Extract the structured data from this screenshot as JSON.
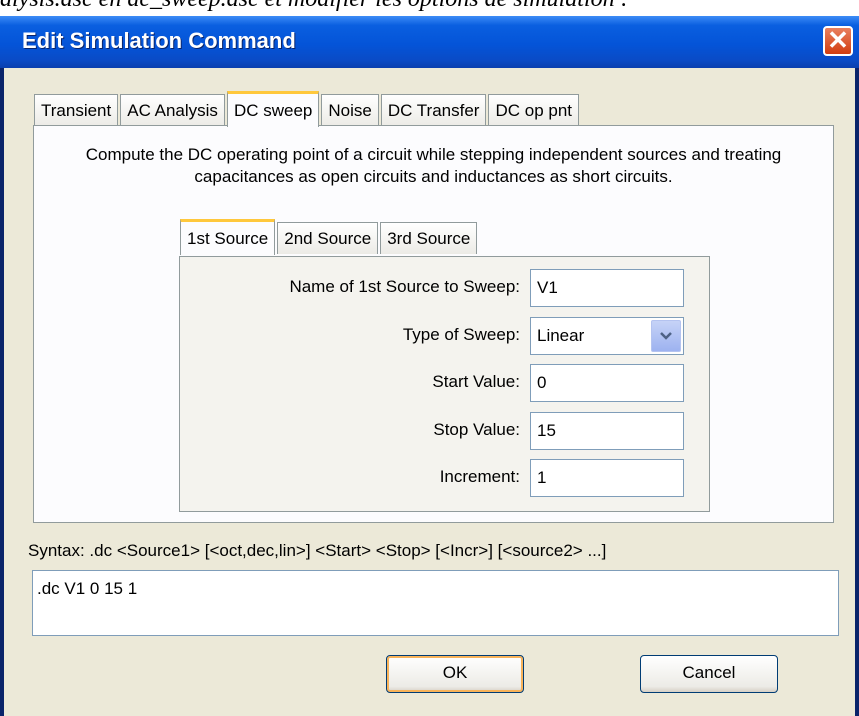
{
  "doc_fragment": "alysis.asc en dc_sweep.asc et modifier les options de simulation :",
  "window": {
    "title": "Edit Simulation Command",
    "close_glyph": "✕"
  },
  "tabs": [
    "Transient",
    "AC Analysis",
    "DC sweep",
    "Noise",
    "DC Transfer",
    "DC op pnt"
  ],
  "active_tab": "DC sweep",
  "description": "Compute the DC operating point of a circuit while stepping independent sources and treating capacitances as open circuits and inductances as short circuits.",
  "source_tabs": [
    "1st Source",
    "2nd Source",
    "3rd Source"
  ],
  "active_source_tab": "1st Source",
  "form": {
    "name_label": "Name of 1st Source to Sweep:",
    "name_value": "V1",
    "type_label": "Type of Sweep:",
    "type_value": "Linear",
    "start_label": "Start Value:",
    "start_value": "0",
    "stop_label": "Stop Value:",
    "stop_value": "15",
    "incr_label": "Increment:",
    "incr_value": "1"
  },
  "syntax": "Syntax:  .dc <Source1> [<oct,dec,lin>] <Start> <Stop> [<Incr>] [<source2> ...]",
  "command_text": ".dc V1 0 15 1",
  "buttons": {
    "ok": "OK",
    "cancel": "Cancel"
  },
  "icons": {
    "dropdown": "chevron-down-icon",
    "close": "close-icon"
  },
  "colors": {
    "titlebar": "#0454d8",
    "active_tab_accent": "#ffc83c",
    "face": "#ece9d8"
  }
}
